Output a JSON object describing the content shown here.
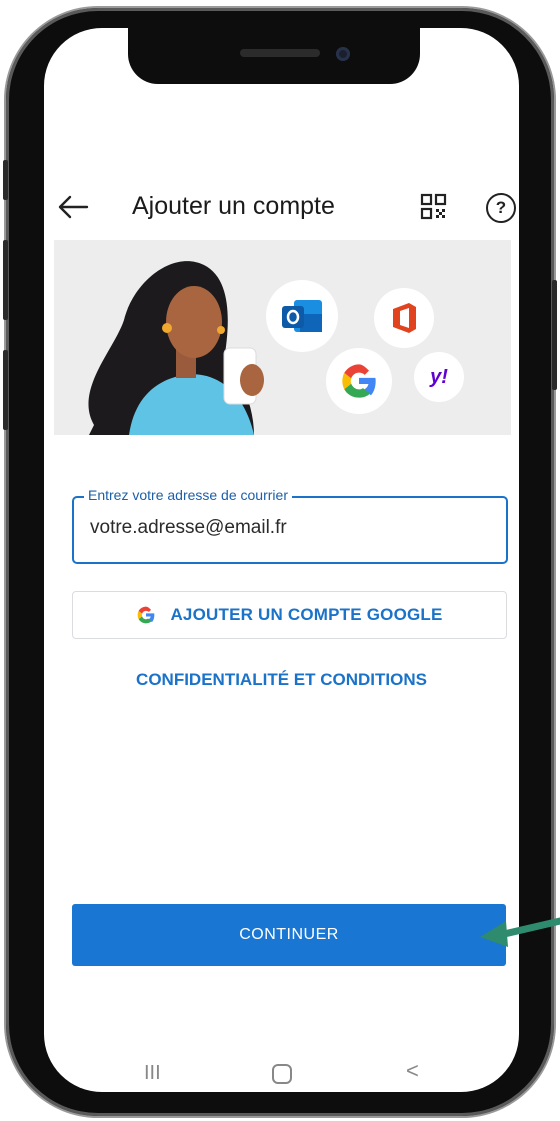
{
  "header": {
    "title": "Ajouter un compte",
    "help_label": "?"
  },
  "email_field": {
    "label": "Entrez votre adresse de courrier",
    "value": "votre.adresse@email.fr"
  },
  "google_button": {
    "label": "AJOUTER UN COMPTE GOOGLE"
  },
  "privacy_link": {
    "label": "CONFIDENTIALITÉ ET CONDITIONS"
  },
  "continue_button": {
    "label": "CONTINUER"
  },
  "icons": {
    "back": "arrow-left-icon",
    "qr": "qr-code-icon",
    "help": "help-icon",
    "google": "google-g-icon",
    "outlook": "outlook-icon",
    "office": "office-icon",
    "yahoo": "yahoo-icon"
  },
  "colors": {
    "accent": "#1976d2",
    "link": "#1a73c9",
    "annotation_arrow": "#2e8b6e"
  },
  "navbar": {
    "recent": "III",
    "back": "<"
  }
}
